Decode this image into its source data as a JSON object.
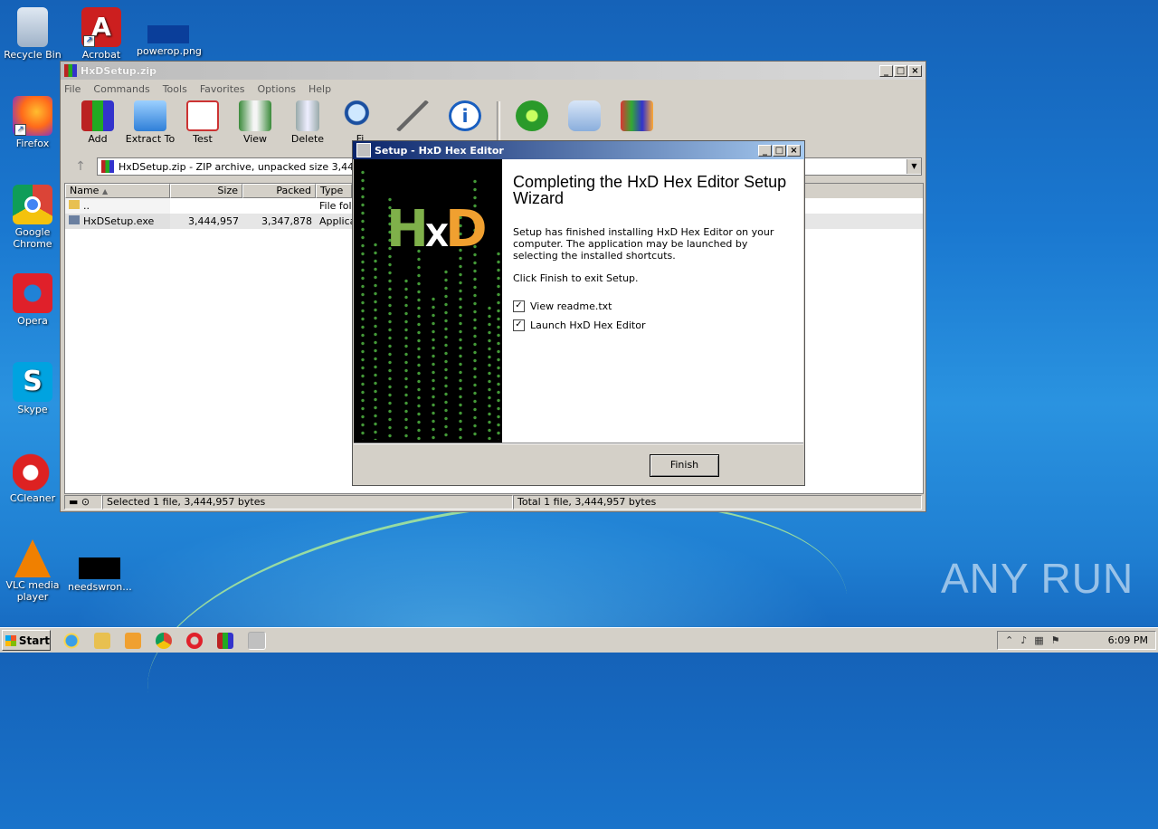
{
  "desktop": {
    "icons": [
      {
        "label": "Recycle Bin"
      },
      {
        "label": "Acrobat"
      },
      {
        "label": "powerop.png"
      },
      {
        "label": "Firefox"
      },
      {
        "label": "Google Chrome"
      },
      {
        "label": "Opera"
      },
      {
        "label": "Skype"
      },
      {
        "label": "CCleaner"
      },
      {
        "label": "VLC media player"
      },
      {
        "label": "needswron..."
      }
    ],
    "watermark": "ANY RUN"
  },
  "winrar": {
    "title": "HxDSetup.zip",
    "menu": [
      "File",
      "Commands",
      "Tools",
      "Favorites",
      "Options",
      "Help"
    ],
    "toolbar": [
      "Add",
      "Extract To",
      "Test",
      "View",
      "Delete",
      "Fi"
    ],
    "address": "HxDSetup.zip - ZIP archive, unpacked size 3,444,9",
    "columns": [
      "Name",
      "Size",
      "Packed",
      "Type"
    ],
    "rows": [
      {
        "name": "..",
        "size": "",
        "packed": "",
        "type": "File fol"
      },
      {
        "name": "HxDSetup.exe",
        "size": "3,444,957",
        "packed": "3,347,878",
        "type": "Applica"
      }
    ],
    "status_left": "Selected 1 file, 3,444,957 bytes",
    "status_right": "Total 1 file, 3,444,957 bytes"
  },
  "setup": {
    "title": "Setup - HxD Hex Editor",
    "logo": {
      "h": "H",
      "x": "X",
      "d": "D"
    },
    "heading": "Completing the HxD Hex Editor Setup Wizard",
    "p1": "Setup has finished installing HxD Hex Editor on your computer. The application may be launched by selecting the installed shortcuts.",
    "p2": "Click Finish to exit Setup.",
    "checks": [
      {
        "label": "View readme.txt",
        "checked": true
      },
      {
        "label": "Launch HxD Hex Editor",
        "checked": true
      }
    ],
    "finish_label": "Finish"
  },
  "taskbar": {
    "start_label": "Start",
    "clock": "6:09 PM"
  }
}
